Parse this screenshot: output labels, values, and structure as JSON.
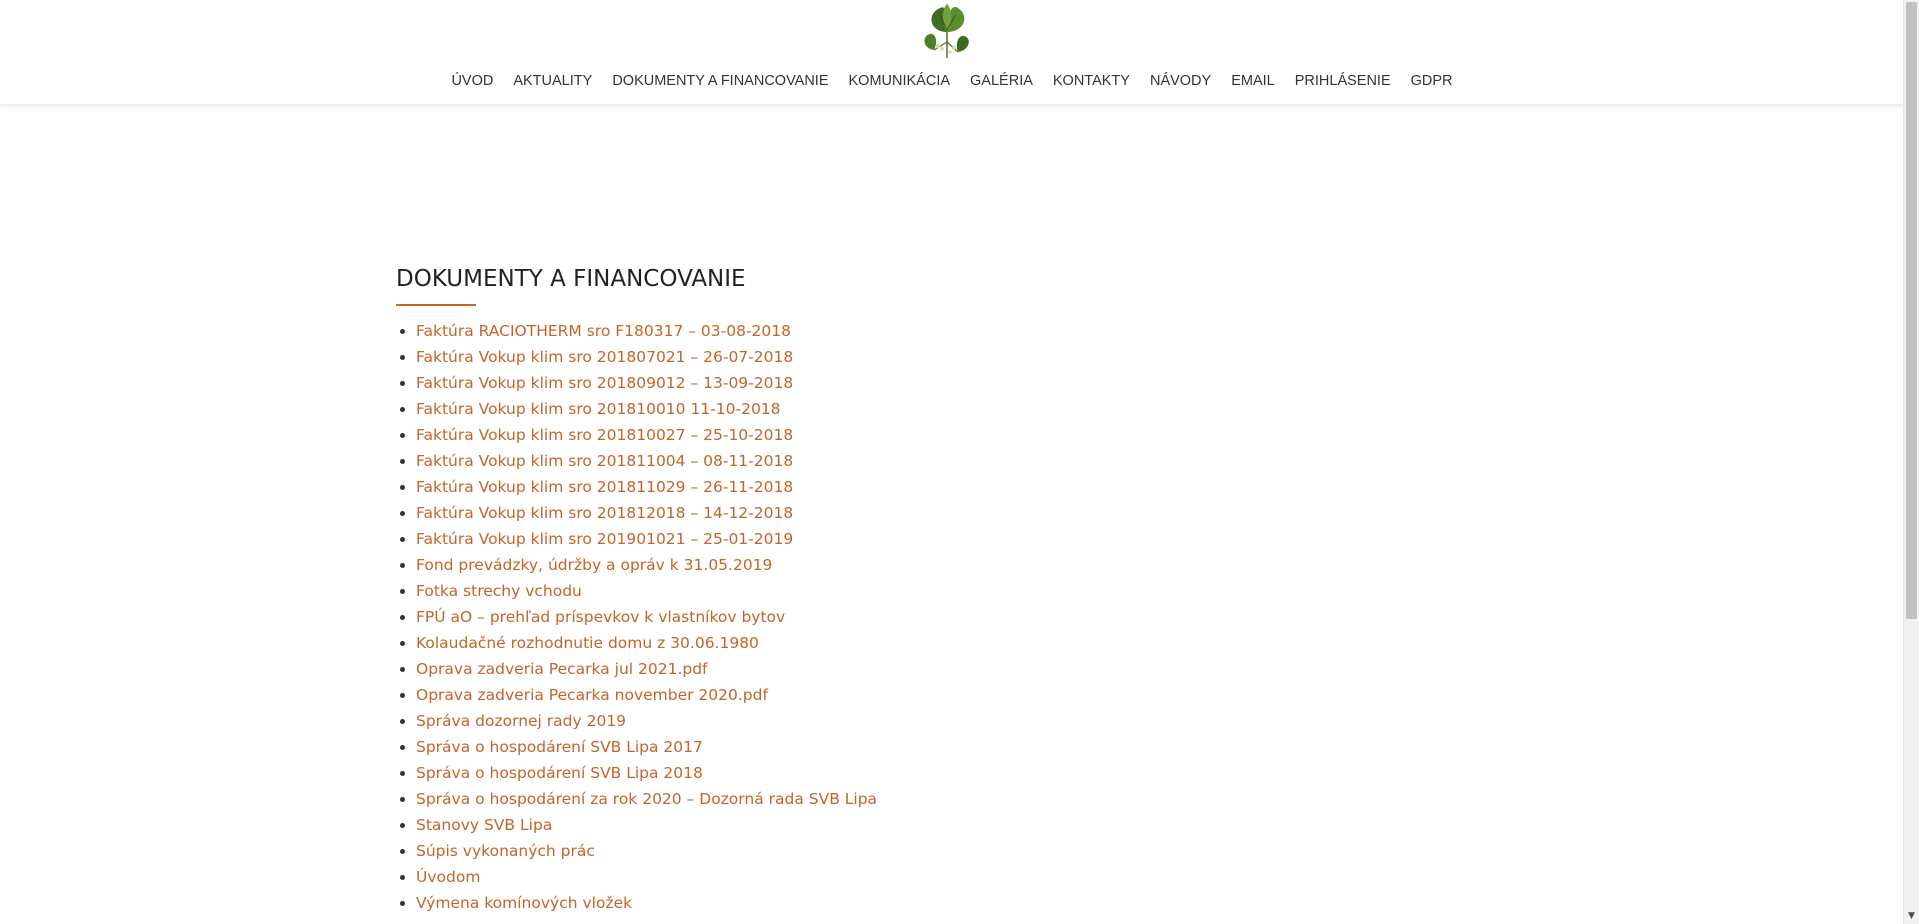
{
  "nav": {
    "items": [
      {
        "label": "ÚVOD"
      },
      {
        "label": "AKTUALITY"
      },
      {
        "label": "DOKUMENTY A FINANCOVANIE"
      },
      {
        "label": "KOMUNIKÁCIA"
      },
      {
        "label": "GALÉRIA"
      },
      {
        "label": "KONTAKTY"
      },
      {
        "label": "NÁVODY"
      },
      {
        "label": "EMAIL"
      },
      {
        "label": "PRIHLÁSENIE"
      },
      {
        "label": "GDPR"
      }
    ]
  },
  "main": {
    "title": "DOKUMENTY A FINANCOVANIE",
    "documents": [
      "Faktúra RACIOTHERM sro F180317 – 03-08-2018",
      "Faktúra Vokup klim sro 201807021 – 26-07-2018",
      "Faktúra Vokup klim sro 201809012 – 13-09-2018",
      "Faktúra Vokup klim sro 201810010 11-10-2018",
      "Faktúra Vokup klim sro 201810027 – 25-10-2018",
      "Faktúra Vokup klim sro 201811004 – 08-11-2018",
      "Faktúra Vokup klim sro 201811029 – 26-11-2018",
      "Faktúra Vokup klim sro 201812018 – 14-12-2018",
      "Faktúra Vokup klim sro 201901021 – 25-01-2019",
      "Fond prevádzky, údržby a opráv k 31.05.2019",
      "Fotka strechy vchodu",
      "FPÚ aO – prehľad príspevkov k vlastníkov bytov",
      "Kolaudačné rozhodnutie domu z 30.06.1980",
      "Oprava zadveria Pecarka jul 2021.pdf",
      "Oprava zadveria Pecarka november 2020.pdf",
      "Správa dozornej rady 2019",
      "Správa o hospodárení SVB Lipa 2017",
      "Správa o hospodárení SVB Lipa 2018",
      "Správa o hospodárení za rok 2020 – Dozorná rada SVB Lipa",
      "Stanovy SVB Lipa",
      "Súpis vykonaných prác",
      "Úvodom",
      "Výmena komínových vložek"
    ]
  },
  "colors": {
    "accent": "#c2652a",
    "text": "#333333",
    "leaf": "#4a7a2c"
  },
  "icons": {
    "logo": "linden-leaf-logo"
  }
}
